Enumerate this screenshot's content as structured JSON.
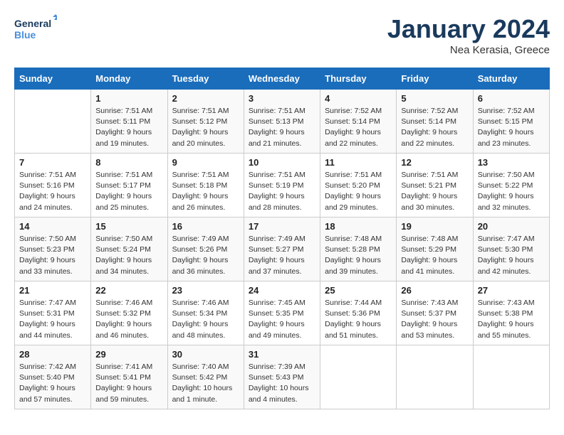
{
  "header": {
    "logo_line1": "General",
    "logo_line2": "Blue",
    "month": "January 2024",
    "location": "Nea Kerasia, Greece"
  },
  "days_of_week": [
    "Sunday",
    "Monday",
    "Tuesday",
    "Wednesday",
    "Thursday",
    "Friday",
    "Saturday"
  ],
  "weeks": [
    [
      {
        "day": "",
        "sunrise": "",
        "sunset": "",
        "daylight": ""
      },
      {
        "day": "1",
        "sunrise": "Sunrise: 7:51 AM",
        "sunset": "Sunset: 5:11 PM",
        "daylight": "Daylight: 9 hours and 19 minutes."
      },
      {
        "day": "2",
        "sunrise": "Sunrise: 7:51 AM",
        "sunset": "Sunset: 5:12 PM",
        "daylight": "Daylight: 9 hours and 20 minutes."
      },
      {
        "day": "3",
        "sunrise": "Sunrise: 7:51 AM",
        "sunset": "Sunset: 5:13 PM",
        "daylight": "Daylight: 9 hours and 21 minutes."
      },
      {
        "day": "4",
        "sunrise": "Sunrise: 7:52 AM",
        "sunset": "Sunset: 5:14 PM",
        "daylight": "Daylight: 9 hours and 22 minutes."
      },
      {
        "day": "5",
        "sunrise": "Sunrise: 7:52 AM",
        "sunset": "Sunset: 5:14 PM",
        "daylight": "Daylight: 9 hours and 22 minutes."
      },
      {
        "day": "6",
        "sunrise": "Sunrise: 7:52 AM",
        "sunset": "Sunset: 5:15 PM",
        "daylight": "Daylight: 9 hours and 23 minutes."
      }
    ],
    [
      {
        "day": "7",
        "sunrise": "Sunrise: 7:51 AM",
        "sunset": "Sunset: 5:16 PM",
        "daylight": "Daylight: 9 hours and 24 minutes."
      },
      {
        "day": "8",
        "sunrise": "Sunrise: 7:51 AM",
        "sunset": "Sunset: 5:17 PM",
        "daylight": "Daylight: 9 hours and 25 minutes."
      },
      {
        "day": "9",
        "sunrise": "Sunrise: 7:51 AM",
        "sunset": "Sunset: 5:18 PM",
        "daylight": "Daylight: 9 hours and 26 minutes."
      },
      {
        "day": "10",
        "sunrise": "Sunrise: 7:51 AM",
        "sunset": "Sunset: 5:19 PM",
        "daylight": "Daylight: 9 hours and 28 minutes."
      },
      {
        "day": "11",
        "sunrise": "Sunrise: 7:51 AM",
        "sunset": "Sunset: 5:20 PM",
        "daylight": "Daylight: 9 hours and 29 minutes."
      },
      {
        "day": "12",
        "sunrise": "Sunrise: 7:51 AM",
        "sunset": "Sunset: 5:21 PM",
        "daylight": "Daylight: 9 hours and 30 minutes."
      },
      {
        "day": "13",
        "sunrise": "Sunrise: 7:50 AM",
        "sunset": "Sunset: 5:22 PM",
        "daylight": "Daylight: 9 hours and 32 minutes."
      }
    ],
    [
      {
        "day": "14",
        "sunrise": "Sunrise: 7:50 AM",
        "sunset": "Sunset: 5:23 PM",
        "daylight": "Daylight: 9 hours and 33 minutes."
      },
      {
        "day": "15",
        "sunrise": "Sunrise: 7:50 AM",
        "sunset": "Sunset: 5:24 PM",
        "daylight": "Daylight: 9 hours and 34 minutes."
      },
      {
        "day": "16",
        "sunrise": "Sunrise: 7:49 AM",
        "sunset": "Sunset: 5:26 PM",
        "daylight": "Daylight: 9 hours and 36 minutes."
      },
      {
        "day": "17",
        "sunrise": "Sunrise: 7:49 AM",
        "sunset": "Sunset: 5:27 PM",
        "daylight": "Daylight: 9 hours and 37 minutes."
      },
      {
        "day": "18",
        "sunrise": "Sunrise: 7:48 AM",
        "sunset": "Sunset: 5:28 PM",
        "daylight": "Daylight: 9 hours and 39 minutes."
      },
      {
        "day": "19",
        "sunrise": "Sunrise: 7:48 AM",
        "sunset": "Sunset: 5:29 PM",
        "daylight": "Daylight: 9 hours and 41 minutes."
      },
      {
        "day": "20",
        "sunrise": "Sunrise: 7:47 AM",
        "sunset": "Sunset: 5:30 PM",
        "daylight": "Daylight: 9 hours and 42 minutes."
      }
    ],
    [
      {
        "day": "21",
        "sunrise": "Sunrise: 7:47 AM",
        "sunset": "Sunset: 5:31 PM",
        "daylight": "Daylight: 9 hours and 44 minutes."
      },
      {
        "day": "22",
        "sunrise": "Sunrise: 7:46 AM",
        "sunset": "Sunset: 5:32 PM",
        "daylight": "Daylight: 9 hours and 46 minutes."
      },
      {
        "day": "23",
        "sunrise": "Sunrise: 7:46 AM",
        "sunset": "Sunset: 5:34 PM",
        "daylight": "Daylight: 9 hours and 48 minutes."
      },
      {
        "day": "24",
        "sunrise": "Sunrise: 7:45 AM",
        "sunset": "Sunset: 5:35 PM",
        "daylight": "Daylight: 9 hours and 49 minutes."
      },
      {
        "day": "25",
        "sunrise": "Sunrise: 7:44 AM",
        "sunset": "Sunset: 5:36 PM",
        "daylight": "Daylight: 9 hours and 51 minutes."
      },
      {
        "day": "26",
        "sunrise": "Sunrise: 7:43 AM",
        "sunset": "Sunset: 5:37 PM",
        "daylight": "Daylight: 9 hours and 53 minutes."
      },
      {
        "day": "27",
        "sunrise": "Sunrise: 7:43 AM",
        "sunset": "Sunset: 5:38 PM",
        "daylight": "Daylight: 9 hours and 55 minutes."
      }
    ],
    [
      {
        "day": "28",
        "sunrise": "Sunrise: 7:42 AM",
        "sunset": "Sunset: 5:40 PM",
        "daylight": "Daylight: 9 hours and 57 minutes."
      },
      {
        "day": "29",
        "sunrise": "Sunrise: 7:41 AM",
        "sunset": "Sunset: 5:41 PM",
        "daylight": "Daylight: 9 hours and 59 minutes."
      },
      {
        "day": "30",
        "sunrise": "Sunrise: 7:40 AM",
        "sunset": "Sunset: 5:42 PM",
        "daylight": "Daylight: 10 hours and 1 minute."
      },
      {
        "day": "31",
        "sunrise": "Sunrise: 7:39 AM",
        "sunset": "Sunset: 5:43 PM",
        "daylight": "Daylight: 10 hours and 4 minutes."
      },
      {
        "day": "",
        "sunrise": "",
        "sunset": "",
        "daylight": ""
      },
      {
        "day": "",
        "sunrise": "",
        "sunset": "",
        "daylight": ""
      },
      {
        "day": "",
        "sunrise": "",
        "sunset": "",
        "daylight": ""
      }
    ]
  ]
}
